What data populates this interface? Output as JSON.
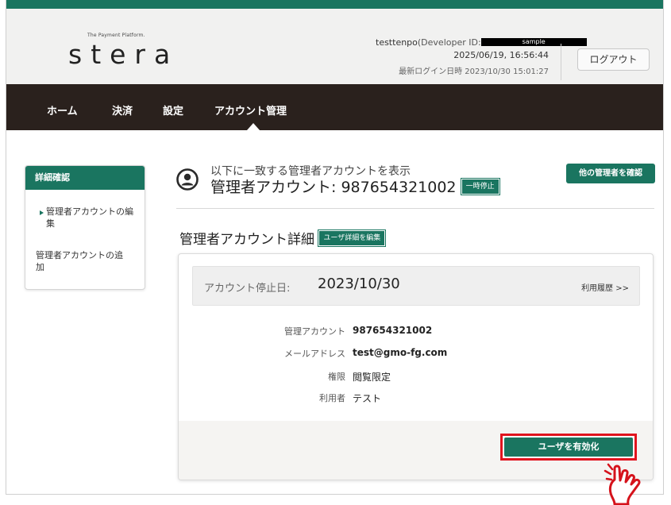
{
  "header": {
    "logo_tagline": "The Payment Platform.",
    "logo": "stera",
    "user_name": "testtenpo",
    "developer_id_label": "(Developer ID:",
    "developer_id_redacted": "sample",
    "datetime": "2025/06/19, 16:56:44",
    "last_login": "最新ログイン日時 2023/10/30 15:01:27",
    "logout_label": "ログアウト"
  },
  "nav": {
    "items": [
      {
        "label": "ホーム"
      },
      {
        "label": "決済"
      },
      {
        "label": "設定"
      },
      {
        "label": "アカウント管理"
      }
    ]
  },
  "sidebar": {
    "heading": "詳細確認",
    "items": [
      {
        "label": "管理者アカウントの編集"
      },
      {
        "label": "管理者アカウントの追加"
      }
    ]
  },
  "main": {
    "subtitle": "以下に一致する管理者アカウントを表示",
    "title_prefix": "管理者アカウント:",
    "account_id": "987654321002",
    "suspended_badge": "一時停止",
    "other_admins_button": "他の管理者を確認",
    "detail_title": "管理者アカウント詳細",
    "edit_user_button": "ユーザ詳細を編集",
    "stop_label": "アカウント停止日:",
    "stop_date": "2023/10/30",
    "usage_history_link": "利用履歴 >>",
    "fields": [
      {
        "label": "管理アカウント",
        "value": "987654321002"
      },
      {
        "label": "メールアドレス",
        "value": "test@gmo-fg.com"
      },
      {
        "label": "権限",
        "value": "閲覧限定"
      },
      {
        "label": "利用者",
        "value": "テスト"
      }
    ],
    "enable_user_button": "ユーザを有効化"
  },
  "colors": {
    "brand_green": "#1a7560",
    "nav_dark": "#2a211d",
    "highlight_red": "#e0141e"
  }
}
